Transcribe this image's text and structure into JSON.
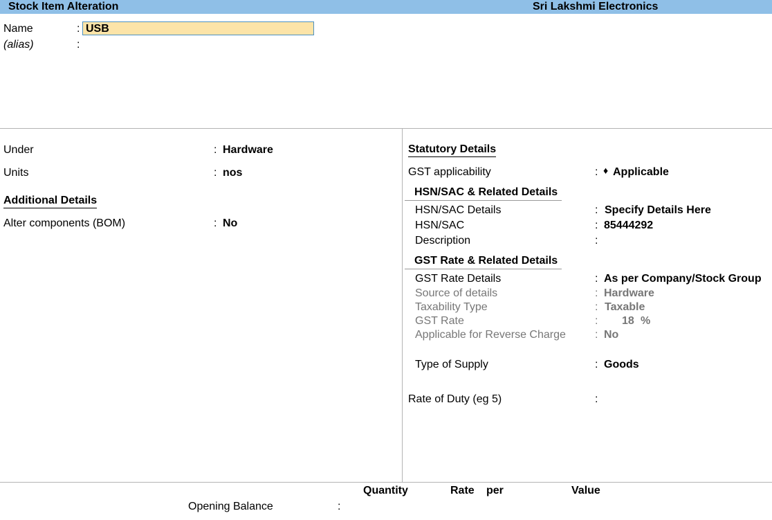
{
  "header": {
    "title": "Stock Item Alteration",
    "company": "Sri Lakshmi Electronics"
  },
  "name_section": {
    "name_label": "Name",
    "name_value": "USB",
    "alias_label": "(alias)",
    "colon": ":"
  },
  "left": {
    "under_label": "Under",
    "under_value": "Hardware",
    "units_label": "Units",
    "units_value": "nos",
    "additional_heading": "Additional Details",
    "bom_label": "Alter components (BOM)",
    "bom_value": "No"
  },
  "right": {
    "statutory_heading": "Statutory Details",
    "gst_app_label": "GST applicability",
    "gst_app_marker": "♦",
    "gst_app_value": "Applicable",
    "hsn_heading": "HSN/SAC & Related Details",
    "hsn_details_label": "HSN/SAC Details",
    "hsn_details_value": "Specify Details Here",
    "hsn_label": "HSN/SAC",
    "hsn_value": "85444292",
    "description_label": "Description",
    "gst_rate_heading": "GST Rate & Related Details",
    "gst_rate_details_label": "GST Rate Details",
    "gst_rate_details_value": "As per Company/Stock Group",
    "source_label": "Source of details",
    "source_value": "Hardware",
    "taxability_label": "Taxability Type",
    "taxability_value": "Taxable",
    "gst_rate_label": "GST Rate",
    "gst_rate_value": "18",
    "gst_rate_unit": "%",
    "reverse_label": "Applicable for Reverse Charge",
    "reverse_value": "No",
    "supply_label": "Type of Supply",
    "supply_value": "Goods",
    "duty_label": "Rate of Duty (eg 5)"
  },
  "footer": {
    "quantity_header": "Quantity",
    "rate_header": "Rate",
    "per_header": "per",
    "value_header": "Value",
    "opening_label": "Opening Balance"
  }
}
